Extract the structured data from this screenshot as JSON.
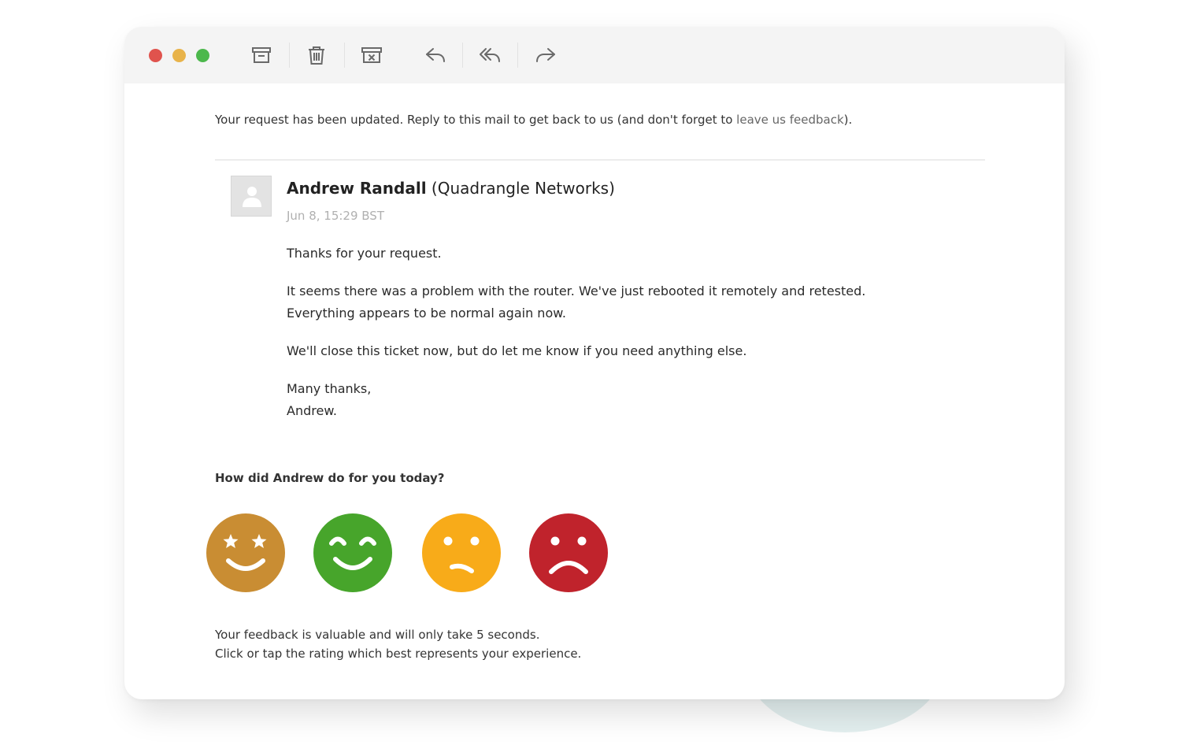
{
  "toolbar": {
    "window_controls": [
      "close",
      "minimize",
      "maximize"
    ],
    "actions": [
      {
        "icon": "archive-icon"
      },
      {
        "icon": "trash-icon"
      },
      {
        "icon": "spam-icon"
      },
      {
        "icon": "reply-icon"
      },
      {
        "icon": "reply-all-icon"
      },
      {
        "icon": "forward-icon"
      }
    ]
  },
  "message": {
    "intro_text": "Your request has been updated. Reply to this mail to get back to us (and don't forget to ",
    "intro_link": "leave us feedback",
    "intro_end": ").",
    "sender_name": "Andrew Randall",
    "sender_org": "(Quadrangle Networks)",
    "date": "Jun 8, 15:29 BST",
    "lines": [
      "Thanks for your request.",
      "It seems there was a problem with the router. We've just rebooted it remotely and retested.",
      "Everything appears to be normal again now.",
      "We'll close this ticket now, but do let me know if you need anything else.",
      "Many thanks,",
      "Andrew."
    ]
  },
  "feedback": {
    "question": "How did Andrew do for you today?",
    "ratings": [
      {
        "name": "rating-excellent",
        "color": "#c98d33"
      },
      {
        "name": "rating-good",
        "color": "#47a52b"
      },
      {
        "name": "rating-okay",
        "color": "#f8ab19"
      },
      {
        "name": "rating-poor",
        "color": "#c0232c"
      }
    ],
    "note_line1": "Your feedback is valuable and will only take 5 seconds.",
    "note_line2": "Click or tap the rating which best represents your experience."
  }
}
